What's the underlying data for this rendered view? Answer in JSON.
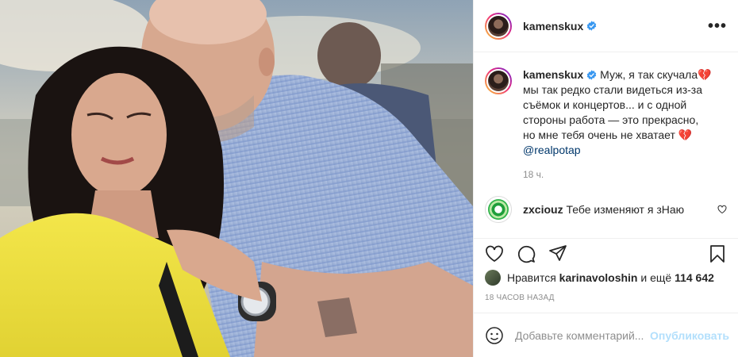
{
  "post": {
    "username": "kamenskux",
    "more_icon": "•••"
  },
  "caption": {
    "username": "kamenskux",
    "text": "Муж, я так скучала💔 мы так редко стали видеться из-за съёмок и концертов... и с одной стороны работа — это прекрасно, но мне тебя очень не хватает 💔",
    "mention": "@realpotap",
    "time": "18 ч."
  },
  "comment": {
    "username": "zxciouz",
    "text": "Тебе изменяют я зНаю"
  },
  "likes": {
    "prefix": "Нравится",
    "user": "karinavoloshin",
    "middle": "и ещё",
    "count": "114 642"
  },
  "timestamp": "18 ЧАСОВ НАЗАД",
  "add_comment": {
    "placeholder": "Добавьте комментарий...",
    "publish": "Опубликовать"
  },
  "colors": {
    "verified": "#3897f0",
    "publish_disabled": "#b2dffc",
    "mention": "#00376b"
  },
  "icons": [
    "verified-icon",
    "more-options-icon",
    "heart-icon",
    "comment-icon",
    "share-icon",
    "bookmark-icon",
    "emoji-icon"
  ]
}
